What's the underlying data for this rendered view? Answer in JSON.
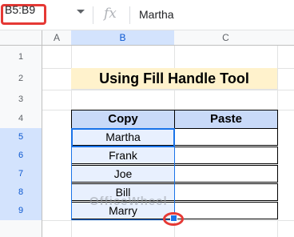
{
  "formula_bar": {
    "name_box": "B5:B9",
    "fx_icon": "fx",
    "formula": "Martha"
  },
  "columns": [
    "A",
    "B",
    "C"
  ],
  "rows": [
    "1",
    "2",
    "3",
    "4",
    "5",
    "6",
    "7",
    "8",
    "9"
  ],
  "sheet": {
    "title": "Using Fill Handle Tool",
    "table_header": {
      "copy": "Copy",
      "paste": "Paste"
    },
    "copy_values": [
      "Martha",
      "Frank",
      "Joe",
      "Bill",
      "Marry"
    ],
    "paste_values": [
      "",
      "",
      "",
      "",
      ""
    ]
  },
  "watermark": "OfficeWheel",
  "colors": {
    "title_fill": "#fff2cc",
    "header_fill": "#c9daf8",
    "selection": "#1a73e8",
    "highlight": "#e53935"
  }
}
